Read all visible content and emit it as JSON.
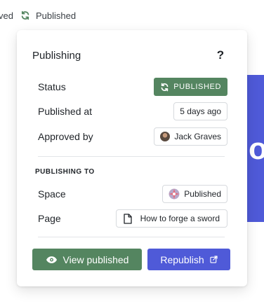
{
  "topbar": {
    "cut_text": "ved",
    "status_text": "Published"
  },
  "background": {
    "accent_color": "#4f5ad8",
    "glyph": "o"
  },
  "popover": {
    "title": "Publishing",
    "help_label": "?",
    "rows": {
      "status": {
        "label": "Status",
        "value": "PUBLISHED"
      },
      "published_at": {
        "label": "Published at",
        "value": "5 days ago"
      },
      "approved_by": {
        "label": "Approved by",
        "value": "Jack Graves"
      }
    },
    "publishing_to": {
      "heading": "PUBLISHING TO",
      "space": {
        "label": "Space",
        "value": "Published"
      },
      "page": {
        "label": "Page",
        "value": "How to forge a sword"
      }
    },
    "actions": {
      "view_published": "View published",
      "republish": "Republish"
    }
  },
  "colors": {
    "published_green": "#548560",
    "republish_blue": "#4f5ad8"
  },
  "icons": [
    "sync-icon",
    "help-icon",
    "avatar",
    "space-icon",
    "document-icon",
    "eye-icon",
    "external-link-icon"
  ]
}
